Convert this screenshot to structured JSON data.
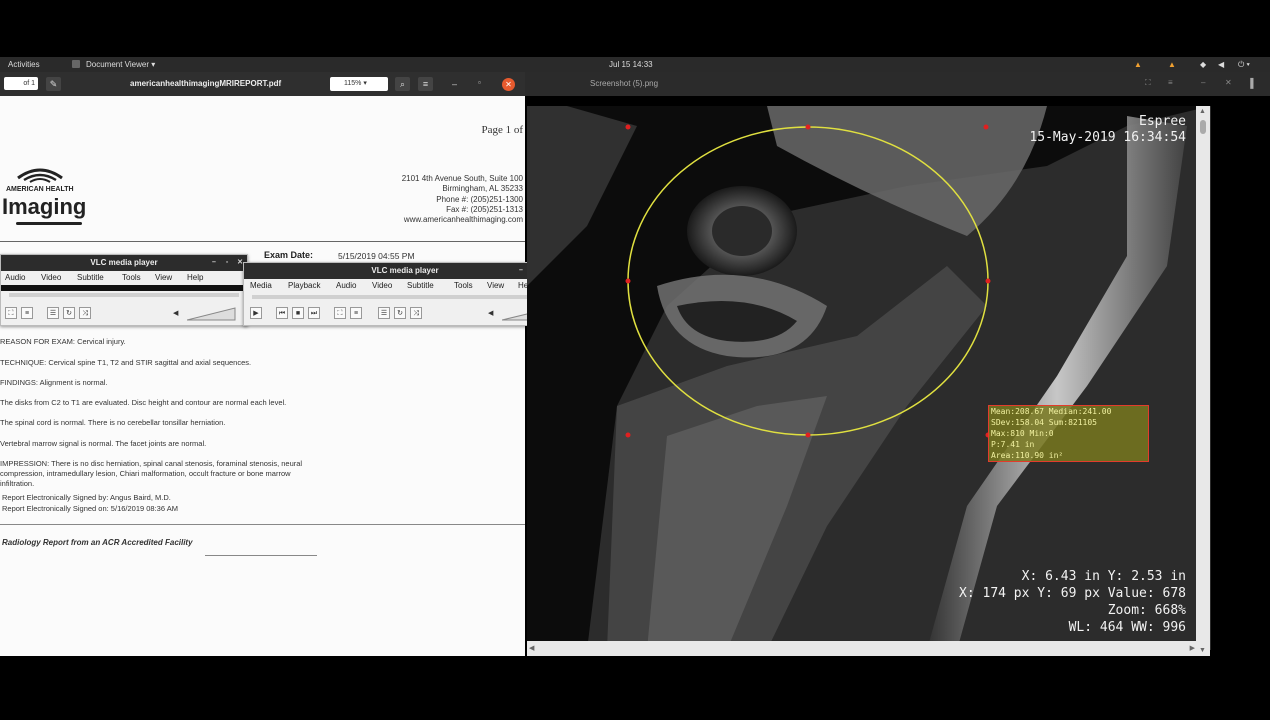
{
  "topbar": {
    "activities": "Activities",
    "app": "Document Viewer ▾",
    "clock": "Jul 15  14:33"
  },
  "pdf_viewer": {
    "page_field": "of 1",
    "filename": "americanhealthimagingMRIREPORT.pdf",
    "zoom": "115% ▾"
  },
  "image_viewer": {
    "filename": "Screenshot (5).png"
  },
  "report": {
    "page": "Page 1 of",
    "logo_top": "AMERICAN HEALTH",
    "logo_main": "Imaging",
    "address": [
      "2101 4th Avenue South, Suite 100",
      "Birmingham, AL 35233",
      "Phone #:   (205)251-1300",
      "Fax #:   (205)251-1313",
      "www.americanhealthimaging.com"
    ],
    "exam_label": "Exam Date:",
    "exam_value": "5/15/2019 04:55 PM",
    "lines": [
      "REASON FOR EXAM: Cervical injury.",
      "TECHNIQUE: Cervical spine T1, T2 and STIR sagittal and axial sequences.",
      "FINDINGS: Alignment is normal.",
      "The disks from C2 to T1 are evaluated. Disc height and contour are normal each level.",
      "The spinal cord is normal. There is no cerebellar tonsillar herniation.",
      "Vertebral marrow signal is normal. The facet joints are normal.",
      "IMPRESSION: There is no disc herniation, spinal canal stenosis, foraminal stenosis, neural",
      "compression, intramedullary lesion, Chiari malformation, occult fracture or bone marrow",
      "infiltration."
    ],
    "signed_by": "Report Electronically Signed by:   Angus Baird, M.D.",
    "signed_on": "Report Electronically Signed on:   5/16/2019 08:36 AM",
    "footer": "Radiology Report from an ACR Accredited Facility"
  },
  "vlc1": {
    "title": "VLC media player",
    "menu": [
      "Audio",
      "Video",
      "Subtitle",
      "Tools",
      "View",
      "Help"
    ]
  },
  "vlc2": {
    "title": "VLC media player",
    "menu": [
      "Media",
      "Playback",
      "Audio",
      "Video",
      "Subtitle",
      "Tools",
      "View",
      "Help"
    ]
  },
  "mri": {
    "institution": "Espree",
    "datetime": "15-May-2019 16:34:54",
    "stats": [
      "Mean:208.67 Median:241.00",
      "SDev:158.04 Sum:821105",
      "Max:810 Min:0",
      "P:7.41 in",
      "Area:110.90 in²"
    ],
    "coord_in": "X: 6.43 in Y: 2.53 in",
    "coord_px": "X: 174 px Y: 69 px Value: 678",
    "zoom": "Zoom: 668%",
    "window": "WL: 464 WW: 996"
  },
  "colors": {
    "roi_circle": "#e0e040",
    "roi_handle": "#e02020",
    "pdf_close": "#e65a2e"
  }
}
